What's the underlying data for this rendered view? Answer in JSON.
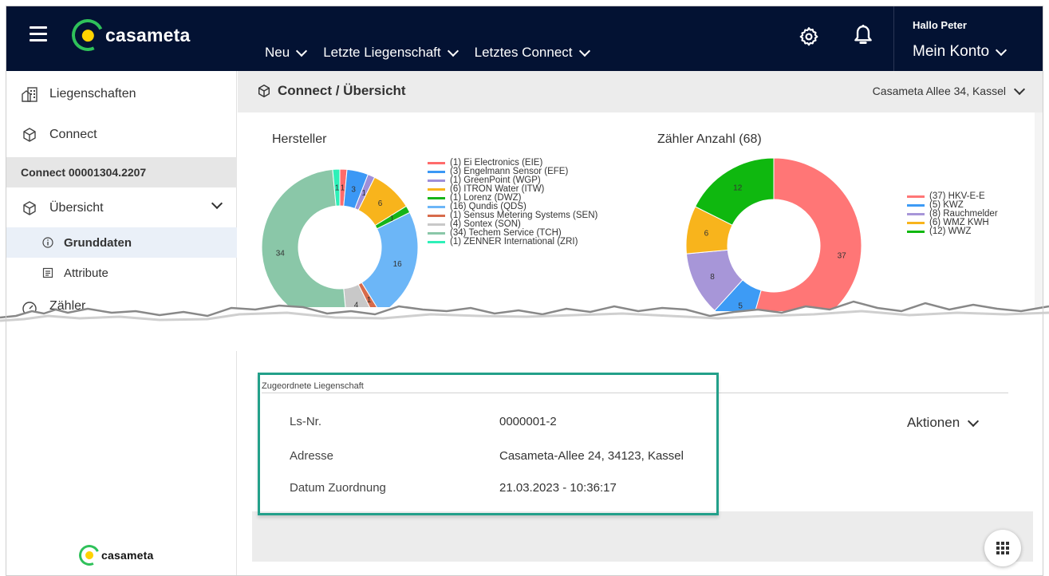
{
  "header": {
    "logo_text": "casameta",
    "nav": [
      {
        "label": "Neu"
      },
      {
        "label": "Letzte Liegenschaft"
      },
      {
        "label": "Letztes Connect"
      }
    ],
    "greeting": "Hallo Peter",
    "account_label": "Mein Konto",
    "icons": [
      "menu-icon",
      "gear-icon",
      "bell-icon"
    ]
  },
  "sidebar": {
    "items": [
      {
        "label": "Liegenschaften",
        "icon": "building-icon"
      },
      {
        "label": "Connect",
        "icon": "cube-icon"
      }
    ],
    "connect_number": "Connect 00001304.2207",
    "overview": {
      "label": "Übersicht",
      "icon": "cube-icon",
      "expanded": true
    },
    "sub_items": [
      {
        "label": "Grunddaten",
        "icon": "info-icon",
        "active": true
      },
      {
        "label": "Attribute",
        "icon": "document-icon",
        "active": false
      }
    ],
    "partial_item": "Zähler",
    "footer_logo_text": "casameta"
  },
  "page": {
    "breadcrumb": "Connect / Übersicht",
    "address_select": "Casameta Allee 34, Kassel"
  },
  "chart_data": [
    {
      "type": "pie",
      "title": "Hersteller",
      "donut": true,
      "legend_position": "right",
      "series": [
        {
          "name": "(1) Ei Electronics (EIE)",
          "value": 1,
          "color": "#ff6b6b"
        },
        {
          "name": "(3) Engelmann Sensor (EFE)",
          "value": 3,
          "color": "#3b98f5"
        },
        {
          "name": "(1) GreenPoint (WGP)",
          "value": 1,
          "color": "#9e8fd9"
        },
        {
          "name": "(6) ITRON Water (ITW)",
          "value": 6,
          "color": "#f8b41c"
        },
        {
          "name": "(1) Lorenz (DWZ)",
          "value": 1,
          "color": "#16b418"
        },
        {
          "name": "(16) Qundis (QDS)",
          "value": 16,
          "color": "#6cb6f7"
        },
        {
          "name": "(1) Sensus Metering Systems (SEN)",
          "value": 1,
          "color": "#d76b4b"
        },
        {
          "name": "(4) Sontex (SON)",
          "value": 4,
          "color": "#c8c8c8"
        },
        {
          "name": "(34) Techem Service (TCH)",
          "value": 34,
          "color": "#8ac7a8"
        },
        {
          "name": "(1) ZENNER International (ZRI)",
          "value": 1,
          "color": "#2ef0b8"
        }
      ]
    },
    {
      "type": "pie",
      "title": "Zähler Anzahl (68)",
      "donut": true,
      "legend_position": "right",
      "series": [
        {
          "name": "(37) HKV-E-E",
          "value": 37,
          "color": "#ff7676"
        },
        {
          "name": "(5) KWZ",
          "value": 5,
          "color": "#3d9bf5"
        },
        {
          "name": "(8) Rauchmelder",
          "value": 8,
          "color": "#a796d8"
        },
        {
          "name": "(6) WMZ KWH",
          "value": 6,
          "color": "#f8b41c"
        },
        {
          "name": "(12) WWZ",
          "value": 12,
          "color": "#0fb80f"
        }
      ]
    }
  ],
  "assigned_property": {
    "section_label": "Zugeordnete Liegenschaft",
    "rows": [
      {
        "label": "Ls-Nr.",
        "value": "0000001-2"
      },
      {
        "label": "Adresse",
        "value": "Casameta-Allee 24, 34123, Kassel"
      },
      {
        "label": "Datum Zuordnung",
        "value": "21.03.2023 - 10:36:17"
      }
    ],
    "actions_label": "Aktionen"
  },
  "colors": {
    "header_bg": "#031233",
    "brand_green": "#2fc15a",
    "brand_yellow": "#ffd200",
    "highlight_border": "#23a08a"
  }
}
